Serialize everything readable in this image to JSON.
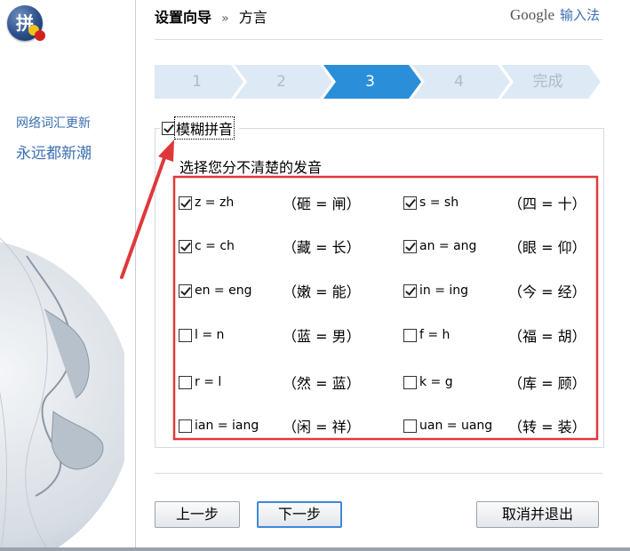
{
  "sidebar": {
    "logo_char": "拼",
    "slogan_line1": "网络词汇更新",
    "slogan_line2": "永远都新潮"
  },
  "header": {
    "title": "设置向导",
    "separator": "»",
    "section": "方言",
    "brand_google": "Google",
    "brand_suffix": "输入法"
  },
  "steps": [
    {
      "label": "1",
      "current": false
    },
    {
      "label": "2",
      "current": false
    },
    {
      "label": "3",
      "current": true
    },
    {
      "label": "4",
      "current": false
    },
    {
      "label": "完成",
      "current": false
    }
  ],
  "fuzzy": {
    "checkbox_label": "模糊拼音",
    "checked": true,
    "hint": "选择您分不清楚的发音",
    "options": [
      {
        "pair": "z = zh",
        "example": "（砸 = 闸）",
        "checked": true
      },
      {
        "pair": "s = sh",
        "example": "（四 = 十）",
        "checked": true
      },
      {
        "pair": "c = ch",
        "example": "（藏 = 长）",
        "checked": true
      },
      {
        "pair": "an = ang",
        "example": "（眼 = 仰）",
        "checked": true
      },
      {
        "pair": "en = eng",
        "example": "（嫩 = 能）",
        "checked": true
      },
      {
        "pair": "in = ing",
        "example": "（今 = 经）",
        "checked": true
      },
      {
        "pair": "l = n",
        "example": "（蓝 = 男）",
        "checked": false
      },
      {
        "pair": "f = h",
        "example": "（福 = 胡）",
        "checked": false
      },
      {
        "pair": "r = l",
        "example": "（然 = 蓝）",
        "checked": false
      },
      {
        "pair": "k = g",
        "example": "（库 = 顾）",
        "checked": false
      },
      {
        "pair": "ian = iang",
        "example": "（闲 = 祥）",
        "checked": false
      },
      {
        "pair": "uan = uang",
        "example": "（转 = 装）",
        "checked": false
      }
    ]
  },
  "buttons": {
    "prev": "上一步",
    "next": "下一步",
    "cancel": "取消并退出"
  },
  "annotation_colors": {
    "highlight_box": "#e0383a",
    "arrow": "#e0383a"
  },
  "colors": {
    "step_inactive": "#dde9f5",
    "step_current": "#2a8fd8",
    "slogan": "#3b6fb0"
  }
}
